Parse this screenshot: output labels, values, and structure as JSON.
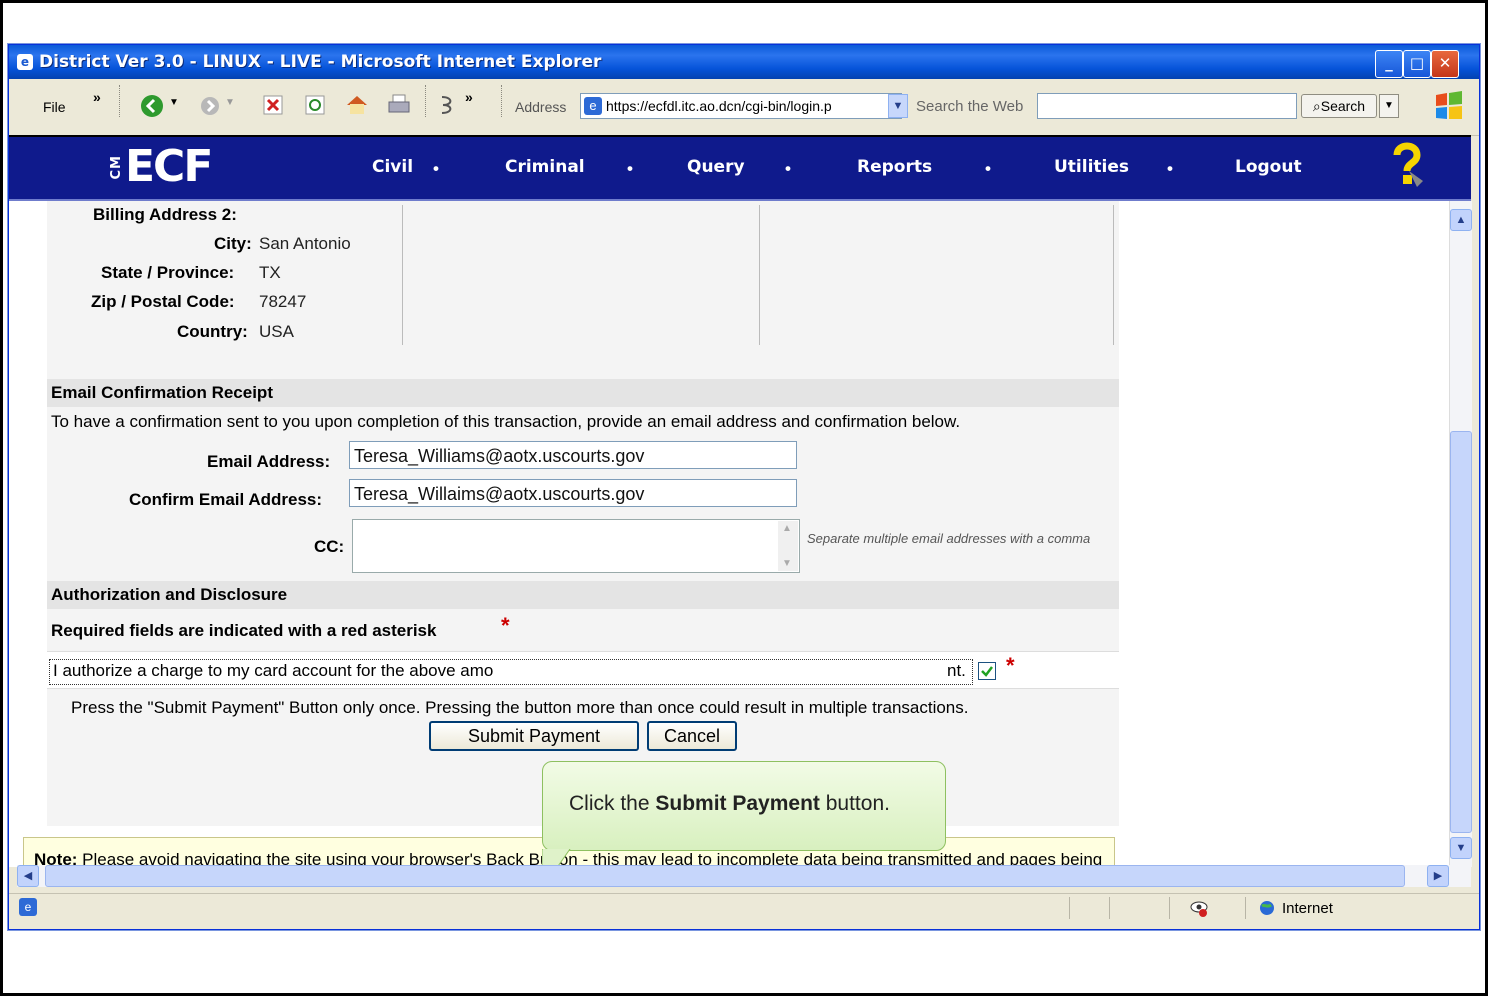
{
  "window": {
    "title": "District Ver 3.0 - LINUX - LIVE - Microsoft Internet Explorer",
    "minimize": "_",
    "maximize": "□",
    "close": "✕"
  },
  "toolbar": {
    "file_menu": "File",
    "chevron": "»",
    "address_label": "Address",
    "address_value": "https://ecfdl.itc.ao.dcn/cgi-bin/login.p",
    "search_placeholder": "Search the Web",
    "search_button": "Search"
  },
  "nav": {
    "logo": "ECF",
    "logo_prefix": "CM",
    "items": [
      "Civil",
      "Criminal",
      "Query",
      "Reports",
      "Utilities",
      "Logout"
    ],
    "dot": "•"
  },
  "billing": {
    "address2_label": "Billing Address 2:",
    "city_label": "City:",
    "city_value": "San Antonio",
    "state_label": "State / Province:",
    "state_value": "TX",
    "zip_label": "Zip / Postal Code:",
    "zip_value": "78247",
    "country_label": "Country:",
    "country_value": "USA"
  },
  "email_section": {
    "heading": "Email Confirmation Receipt",
    "instructions": "To have a confirmation sent to you upon completion of this transaction, provide an email address and confirmation below.",
    "email_label": "Email Address:",
    "email_value": "Teresa_Williams@aotx.uscourts.gov",
    "confirm_label": "Confirm Email Address:",
    "confirm_value": "Teresa_Willaims@aotx.uscourts.gov",
    "cc_label": "CC:",
    "cc_hint": "Separate multiple email addresses with a comma"
  },
  "auth_section": {
    "heading": "Authorization and Disclosure",
    "required_note": "Required fields are indicated with a red asterisk",
    "asterisk": "*",
    "authorize_text_start": "I authorize a charge to my card account for the above amo",
    "authorize_text_end": "nt.",
    "press_once": "Press the \"Submit Payment\" Button only once. Pressing the button more than once could result in multiple transactions.",
    "submit_label": "Submit Payment",
    "cancel_label": "Cancel"
  },
  "note": {
    "bold": "Note:",
    "text": " Please avoid navigating the site using your browser's Back Button - this may lead to incomplete data being transmitted and pages being loaded incorrectly. Please use the links provided whenever possible."
  },
  "callout": {
    "prefix": "Click the ",
    "bold": "Submit Payment",
    "suffix": " button."
  },
  "status": {
    "zone": "Internet"
  }
}
